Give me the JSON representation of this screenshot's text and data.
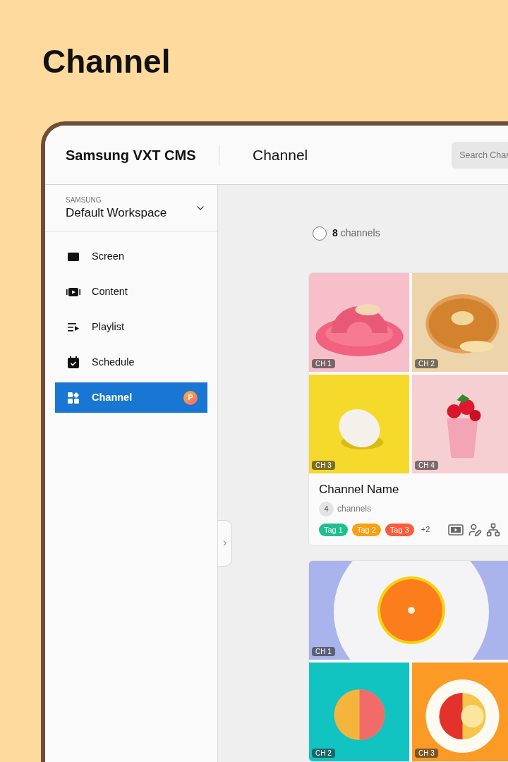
{
  "page_title": "Channel",
  "app": {
    "logo": "Samsung VXT CMS",
    "title": "Channel",
    "search": {
      "placeholder": "Search Char"
    }
  },
  "sidebar": {
    "workspace": {
      "org": "SAMSUNG",
      "name": "Default Workspace"
    },
    "items": [
      {
        "label": "Screen",
        "kind": "screen",
        "selected": false
      },
      {
        "label": "Content",
        "kind": "content",
        "selected": false
      },
      {
        "label": "Playlist",
        "kind": "playlist",
        "selected": false
      },
      {
        "label": "Schedule",
        "kind": "schedule",
        "selected": false
      },
      {
        "label": "Channel",
        "kind": "channel",
        "selected": true,
        "badge": "P"
      }
    ]
  },
  "content": {
    "count": "8",
    "count_label": "channels",
    "select_all_checked": false,
    "cards": [
      {
        "tiles": [
          {
            "label": "CH 1",
            "wide": false
          },
          {
            "label": "CH 2",
            "wide": false
          },
          {
            "label": "CH 3",
            "wide": false
          },
          {
            "label": "CH 4",
            "wide": false
          }
        ],
        "name": "Channel Name",
        "count": "4",
        "count_label": "channels",
        "tags": [
          {
            "label": "Tag 1",
            "color": "#1fbf8f"
          },
          {
            "label": "Tag 2",
            "color": "#ff9f0f"
          },
          {
            "label": "Tag 3",
            "color": "#ff5a3c"
          }
        ],
        "more": "+2"
      },
      {
        "tiles": [
          {
            "label": "CH 1",
            "wide": true
          },
          {
            "label": "CH 2",
            "wide": false
          },
          {
            "label": "CH 3",
            "wide": false
          }
        ]
      }
    ]
  }
}
